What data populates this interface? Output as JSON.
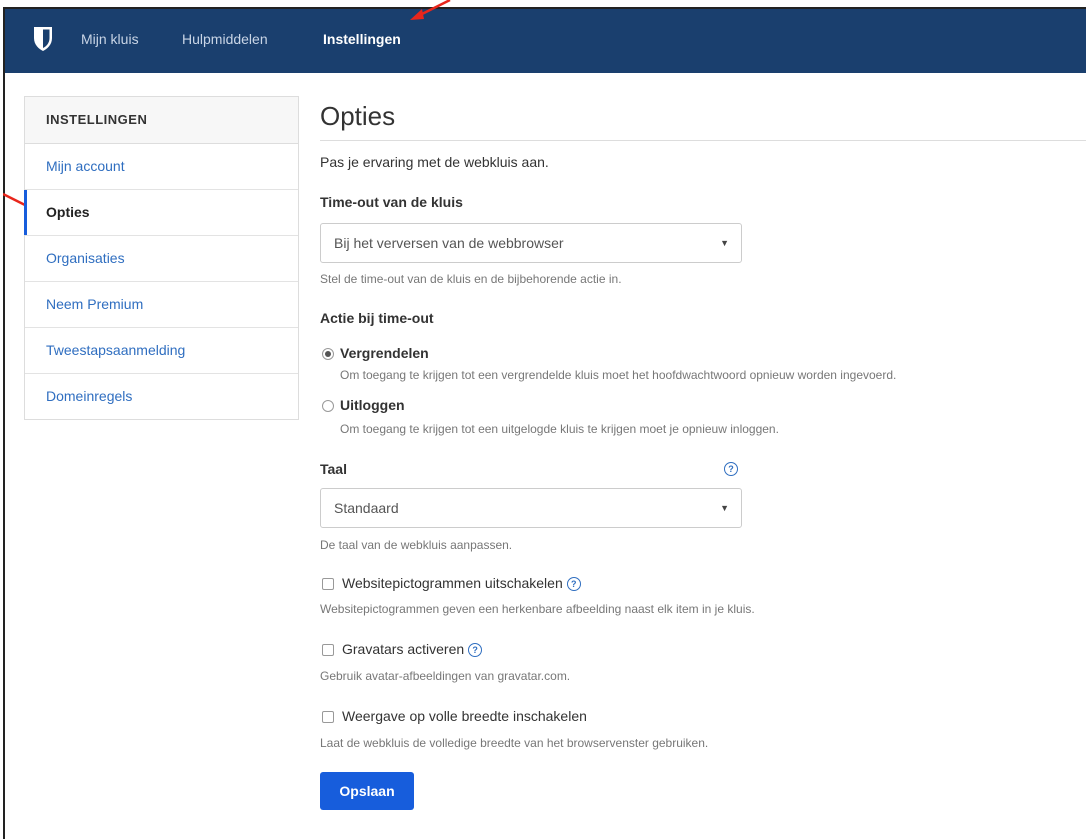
{
  "nav": {
    "items": [
      "Mijn kluis",
      "Hulpmiddelen",
      "Instellingen"
    ],
    "active": "Instellingen",
    "bg_color": "#1a3f6e"
  },
  "sidebar": {
    "header": "INSTELLINGEN",
    "items": [
      "Mijn account",
      "Opties",
      "Organisaties",
      "Neem Premium",
      "Tweestapsaanmelding",
      "Domeinregels"
    ],
    "active": "Opties"
  },
  "main": {
    "title": "Opties",
    "intro": "Pas je ervaring met de webkluis aan.",
    "timeout": {
      "label": "Time-out van de kluis",
      "selected": "Bij het verversen van de webbrowser",
      "help": "Stel de time-out van de kluis en de bijbehorende actie in."
    },
    "action": {
      "label": "Actie bij time-out",
      "options": [
        {
          "label": "Vergrendelen",
          "desc": "Om toegang te krijgen tot een vergrendelde kluis moet het hoofdwachtwoord opnieuw worden ingevoerd.",
          "checked": true
        },
        {
          "label": "Uitloggen",
          "desc": "Om toegang te krijgen tot een uitgelogde kluis te krijgen moet je opnieuw inloggen.",
          "checked": false
        }
      ]
    },
    "language": {
      "label": "Taal",
      "selected": "Standaard",
      "help": "De taal van de webkluis aanpassen."
    },
    "checkboxes": [
      {
        "label": "Websitepictogrammen uitschakelen",
        "desc": "Websitepictogrammen geven een herkenbare afbeelding naast elk item in je kluis.",
        "has_help": true,
        "checked": false
      },
      {
        "label": "Gravatars activeren",
        "desc": "Gebruik avatar-afbeeldingen van gravatar.com.",
        "has_help": true,
        "checked": false
      },
      {
        "label": "Weergave op volle breedte inschakelen",
        "desc": "Laat de webkluis de volledige breedte van het browservenster gebruiken.",
        "has_help": false,
        "checked": false
      }
    ],
    "save_label": "Opslaan",
    "accent_color": "#175ddc"
  },
  "annotation_color": "#e8261c"
}
